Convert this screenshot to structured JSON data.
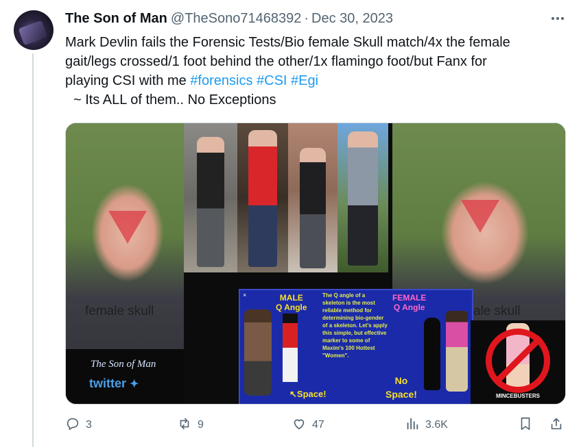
{
  "author": {
    "name": "The Son of Man",
    "handle": "@TheSono71468392",
    "separator": "·",
    "date": "Dec 30, 2023"
  },
  "tweet": {
    "text_line1": "Mark Devlin fails the Forensic Tests/Bio female Skull match/4x the female",
    "text_line2": "gait/legs crossed/1 foot behind the other/1x flamingo foot/but Fanx for",
    "text_line3_prefix": "playing CSI with me ",
    "hashtags": [
      "#forensics",
      "#CSI",
      "#Egi"
    ],
    "text_line4": "~ Its ALL of them.. No Exceptions"
  },
  "media": {
    "left_label": "female skull",
    "right_label": "ale skull",
    "brand_script": "The Son of Man",
    "brand_twitter": "twitter",
    "q_panel": {
      "close": "×",
      "male_title_1": "MALE",
      "male_title_2": "Q Angle",
      "female_title_1": "FEMALE",
      "female_title_2": "Q Angle",
      "text": "The Q angle of a skeleton is the most reliable method for determining bio-gender of a skeleton. Let's apply this simple, but effective marker to some of Maxim's 100 Hottest \"Women\".",
      "space_left": "Space!",
      "space_right_1": "No",
      "space_right_2": "Space!"
    },
    "no_caption": "MINCEBUSTERS"
  },
  "actions": {
    "replies": "3",
    "reposts": "9",
    "likes": "47",
    "views": "3.6K"
  },
  "colors": {
    "accent": "#1d9bf0",
    "secondary_text": "#536471",
    "primary_text": "#0f1419"
  },
  "icons": [
    "more-icon",
    "reply-icon",
    "repost-icon",
    "like-icon",
    "views-icon",
    "bookmark-icon",
    "share-icon"
  ]
}
